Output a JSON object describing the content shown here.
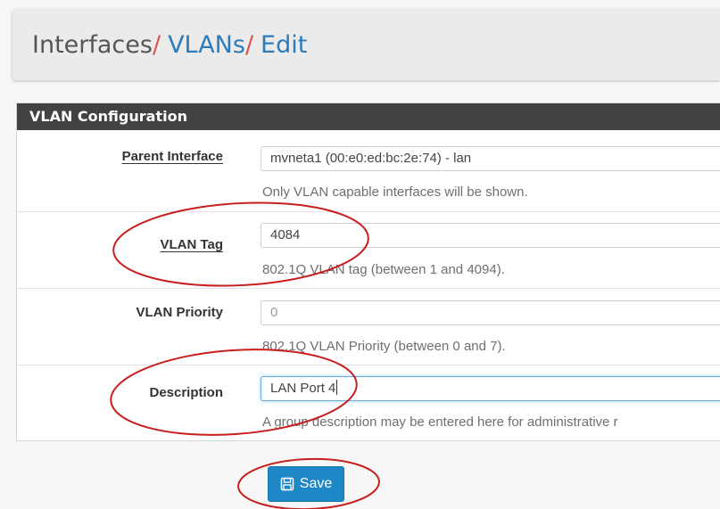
{
  "breadcrumb": {
    "items": [
      {
        "label": "Interfaces",
        "sep": "/"
      },
      {
        "label": "VLANs",
        "sep": "/"
      },
      {
        "label": "Edit",
        "sep": ""
      }
    ]
  },
  "panel": {
    "title": "VLAN Configuration",
    "rows": [
      {
        "label": "Parent Interface",
        "value": "mvneta1 (00:e0:ed:bc:2e:74) - lan",
        "help": "Only VLAN capable interfaces will be shown."
      },
      {
        "label": "VLAN Tag",
        "value": "4084",
        "help": "802.1Q VLAN tag (between 1 and 4094)."
      },
      {
        "label": "VLAN Priority",
        "value": "0",
        "help": "802.1Q VLAN Priority (between 0 and 7)."
      },
      {
        "label": "Description",
        "value": "LAN Port 4",
        "help": "A group description may be entered here for administrative r"
      }
    ]
  },
  "save_button": {
    "label": "Save",
    "icon": "floppy-disk-icon"
  },
  "colors": {
    "accent": "#1e88c7",
    "link": "#2d7bb8",
    "separator": "#d9534f",
    "heading_bg": "#424242",
    "annotation": "#c81e1e"
  }
}
